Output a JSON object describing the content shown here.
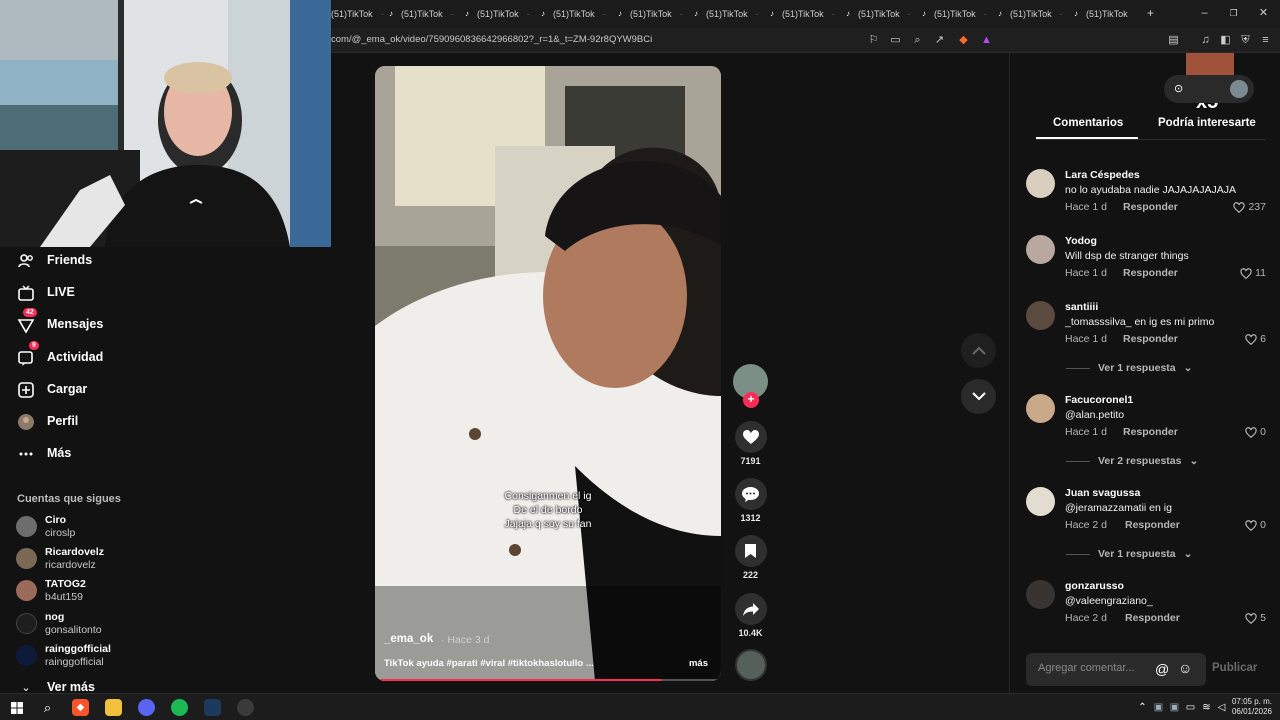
{
  "browser": {
    "tabs": [
      {
        "label": "(51)TikTok"
      },
      {
        "label": "(51)TikTok"
      },
      {
        "label": "(51)TikTok"
      },
      {
        "label": "(51)TikTok"
      },
      {
        "label": "(51)TikTok"
      },
      {
        "label": "(51)TikTok"
      },
      {
        "label": "(51)TikTok"
      },
      {
        "label": "(51)TikTok"
      },
      {
        "label": "(51)TikTok"
      },
      {
        "label": "(51)TikTok"
      },
      {
        "label": "(51)TikTok"
      }
    ],
    "new_tab": "+",
    "url": "com/@_ema_ok/video/7590960836642966802?_r=1&_t=ZM-92r8QYW9BCi"
  },
  "sidebar": {
    "nav": {
      "friends": "Friends",
      "live": "LIVE",
      "messages": "Mensajes",
      "messages_badge": "42",
      "activity": "Actividad",
      "activity_badge": "9",
      "upload": "Cargar",
      "profile": "Perfil",
      "more": "Más"
    },
    "following_title": "Cuentas que sigues",
    "accounts": [
      {
        "name": "Ciro",
        "handle": "ciroslp"
      },
      {
        "name": "Ricardovelz",
        "handle": "ricardovelz"
      },
      {
        "name": "TATOG2",
        "handle": "b4ut159"
      },
      {
        "name": "nog",
        "handle": "gonsalitonto"
      },
      {
        "name": "rainggofficial",
        "handle": "rainggofficial"
      }
    ],
    "see_more": "Ver más"
  },
  "video": {
    "caption_lines": [
      "Consiganmen el ig",
      "De el de bordo",
      "Jajaja q soy su fan"
    ],
    "author": "_ema_ok",
    "posted": "· Hace 3 d",
    "description": "TikTok ayuda #parati #viral #tiktokhaslotullo ...",
    "more": "más",
    "progress": 0.83,
    "likes": "7191",
    "comments": "1312",
    "saves": "222",
    "shares": "10.4K"
  },
  "panel": {
    "overlay_text": "x5",
    "tabs": {
      "comments": "Comentarios",
      "suggested": "Podría interesarte"
    },
    "comments": [
      {
        "name": "Lara Céspedes",
        "text": "no lo ayudaba nadie JAJAJAJAJAJA",
        "time": "Hace 1 d",
        "reply": "Responder",
        "likes": "237"
      },
      {
        "name": "Yodog",
        "text": "Will dsp de stranger things",
        "time": "Hace 1 d",
        "reply": "Responder",
        "likes": "11"
      },
      {
        "name": "santiiii",
        "text": "_tomasssilva_ en ig es mi primo",
        "time": "Hace 1 d",
        "reply": "Responder",
        "likes": "6"
      },
      {
        "name": "Facucoronel1",
        "text": "@alan.petito",
        "time": "Hace 1 d",
        "reply": "Responder",
        "likes": "0"
      },
      {
        "name": "Juan svagussa",
        "text": "@jeramazzamatii en ig",
        "time": "Hace 2 d",
        "reply": "Responder",
        "likes": "0"
      },
      {
        "name": "gonzarusso",
        "text": "@valeengraziano_",
        "time": "Hace 2 d",
        "reply": "Responder",
        "likes": "5"
      }
    ],
    "replies": [
      "Ver 1 respuesta",
      "Ver 2 respuestas",
      "Ver 1 respuesta"
    ],
    "input_placeholder": "Agregar comentar...",
    "publish": "Publicar"
  },
  "taskbar": {
    "time": "07:05 p. m.",
    "date": "06/01/2026"
  },
  "colors": {
    "accent": "#fe2c55",
    "background": "#121212"
  }
}
